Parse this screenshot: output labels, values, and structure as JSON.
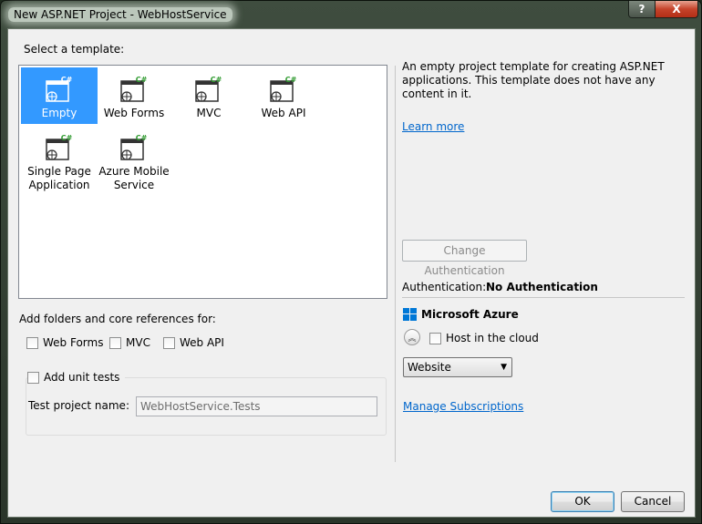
{
  "window": {
    "title": "New ASP.NET Project - WebHostService",
    "help_glyph": "?",
    "close_glyph": "X"
  },
  "templates": {
    "header": "Select a template:",
    "items": [
      {
        "label": "Empty",
        "selected": true
      },
      {
        "label": "Web Forms",
        "selected": false
      },
      {
        "label": "MVC",
        "selected": false
      },
      {
        "label": "Web API",
        "selected": false
      },
      {
        "label": "Single Page Application",
        "selected": false
      },
      {
        "label": "Azure Mobile Service",
        "selected": false
      }
    ],
    "icon_badge": "C#",
    "selected_color": "#3399ff"
  },
  "references": {
    "header": "Add folders and core references for:",
    "options": [
      {
        "label": "Web Forms",
        "checked": false
      },
      {
        "label": "MVC",
        "checked": false
      },
      {
        "label": "Web API",
        "checked": false
      }
    ]
  },
  "unit_tests": {
    "label": "Add unit tests",
    "checked": false,
    "test_project_label": "Test project name:",
    "test_project_value": "WebHostService.Tests"
  },
  "details": {
    "description": "An empty project template for creating ASP.NET applications. This template does not have any content in it.",
    "learn_more": "Learn more"
  },
  "authentication": {
    "change_button": "Change Authentication",
    "label": "Authentication:",
    "value": "No Authentication"
  },
  "azure": {
    "title": "Microsoft Azure",
    "host_label": "Host in the cloud",
    "host_checked": false,
    "expander_glyph": "︽",
    "hosting_type": "Website",
    "manage_link": "Manage Subscriptions",
    "logo_color": "#0078d7"
  },
  "buttons": {
    "ok": "OK",
    "cancel": "Cancel"
  }
}
